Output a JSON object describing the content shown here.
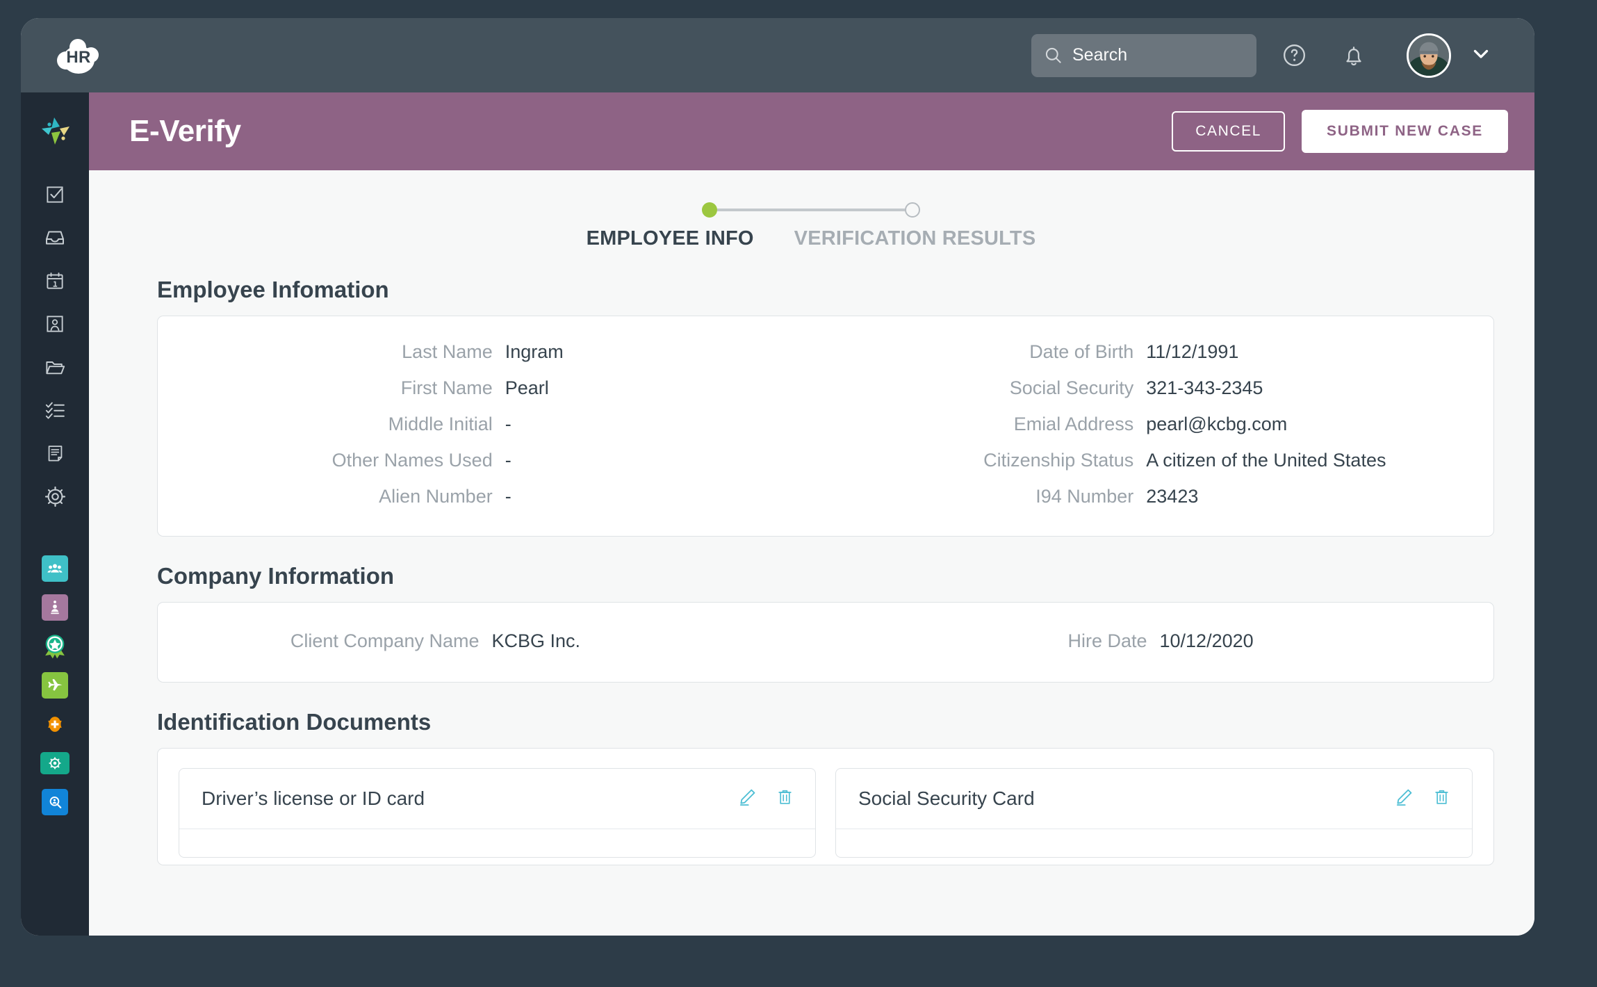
{
  "topbar": {
    "logo_text": "HR",
    "search_placeholder": "Search",
    "help_icon": "question-circle-icon",
    "bell_icon": "bell-icon",
    "avatar_label": "user-avatar",
    "chevron_icon": "chevron-down-icon"
  },
  "sidebar": {
    "brand_icon": "pinwheel-logo-icon",
    "items": [
      {
        "icon": "checkbox-icon"
      },
      {
        "icon": "inbox-icon"
      },
      {
        "icon": "calendar-icon"
      },
      {
        "icon": "employee-card-icon"
      },
      {
        "icon": "folder-icon"
      },
      {
        "icon": "checklist-icon"
      },
      {
        "icon": "document-icon"
      },
      {
        "icon": "gear-icon"
      }
    ],
    "apps": [
      {
        "icon": "people-app-icon",
        "color": "#3fc0c7"
      },
      {
        "icon": "clipboard-app-icon",
        "color": "#a5789e"
      },
      {
        "icon": "award-badge-app-icon",
        "color": "#19b58a"
      },
      {
        "icon": "airplane-app-icon",
        "color": "#86c440"
      },
      {
        "icon": "plus-shield-app-icon",
        "color": "#f29100"
      },
      {
        "icon": "monitor-gear-app-icon",
        "color": "#14a88a"
      },
      {
        "icon": "search-doc-app-icon",
        "color": "#1184d8"
      }
    ]
  },
  "page_header": {
    "title": "E-Verify",
    "cancel_label": "CANCEL",
    "submit_label": "SUBMIT NEW CASE",
    "accent_color": "#8e6385"
  },
  "stepper": {
    "active_color": "#9cc740",
    "steps": [
      {
        "label": "EMPLOYEE INFO",
        "state": "active"
      },
      {
        "label": "VERIFICATION RESULTS",
        "state": "inactive"
      }
    ]
  },
  "employee_section": {
    "title": "Employee Infomation",
    "left_fields": [
      {
        "label": "Last Name",
        "value": "Ingram"
      },
      {
        "label": "First Name",
        "value": "Pearl"
      },
      {
        "label": "Middle Initial",
        "value": "-"
      },
      {
        "label": "Other Names Used",
        "value": "-"
      },
      {
        "label": "Alien Number",
        "value": "-"
      }
    ],
    "right_fields": [
      {
        "label": "Date of Birth",
        "value": "11/12/1991"
      },
      {
        "label": "Social Security",
        "value": "321-343-2345"
      },
      {
        "label": "Emial Address",
        "value": "pearl@kcbg.com"
      },
      {
        "label": "Citizenship Status",
        "value": "A citizen of the United States"
      },
      {
        "label": "I94 Number",
        "value": "23423"
      }
    ]
  },
  "company_section": {
    "title": "Company Information",
    "left_fields": [
      {
        "label": "Client Company Name",
        "value": "KCBG Inc."
      }
    ],
    "right_fields": [
      {
        "label": "Hire Date",
        "value": "10/12/2020"
      }
    ]
  },
  "documents_section": {
    "title": "Identification Documents",
    "documents": [
      {
        "title": "Driver’s license or ID card",
        "edit_icon": "pencil-icon",
        "delete_icon": "trash-icon"
      },
      {
        "title": "Social Security Card",
        "edit_icon": "pencil-icon",
        "delete_icon": "trash-icon"
      }
    ],
    "action_color": "#4dbed4"
  }
}
